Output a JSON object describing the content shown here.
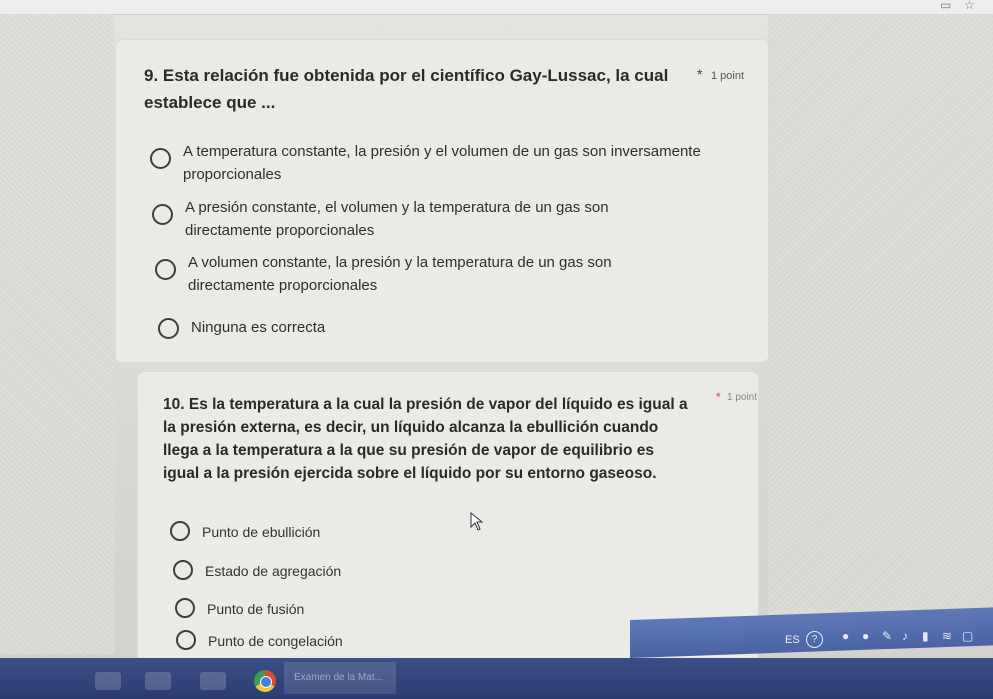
{
  "question9": {
    "title": "9. Esta relación fue obtenida por el científico Gay-Lussac, la cual establece que ...",
    "required_mark": "*",
    "points": "1 point",
    "options": [
      "A temperatura constante, la presión y el volumen de un gas son inversamente proporcionales",
      "A presión constante, el volumen y la temperatura de un gas son directamente proporcionales",
      "A volumen constante, la presión y la temperatura de un gas son directamente proporcionales",
      "Ninguna es correcta"
    ]
  },
  "question10": {
    "title": "10. Es la temperatura a la cual la presión de vapor del líquido es igual a la presión externa, es decir, un líquido alcanza la ebullición cuando llega a la temperatura a la que su presión de vapor de equilibrio es igual a la presión ejercida sobre el líquido por su entorno gaseoso.",
    "required_mark": "*",
    "points": "1 point",
    "options": [
      "Punto de ebullición",
      "Estado de agregación",
      "Punto de fusión",
      "Punto de congelación"
    ]
  },
  "taskbar": {
    "language": "ES",
    "help_glyph": "?",
    "window_label": "Examen de la Mat..."
  },
  "icons": {
    "cursor": "mouse-pointer-icon",
    "browser": "chrome-icon",
    "help": "help-icon",
    "bookmark": "star-icon"
  },
  "colors": {
    "required_q10": "#c94a4a",
    "taskbar": "#2b3d70"
  }
}
